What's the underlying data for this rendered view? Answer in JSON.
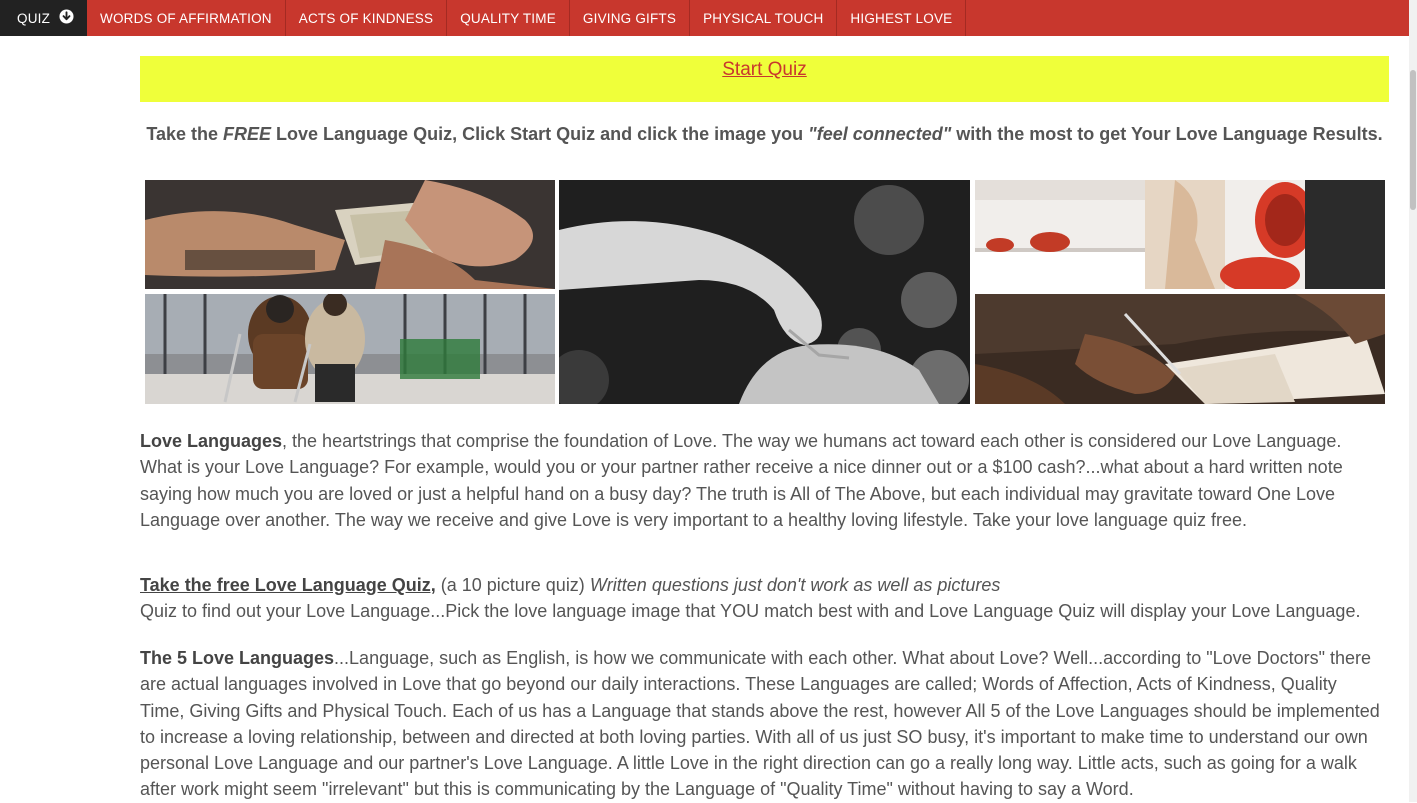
{
  "nav": {
    "items": [
      {
        "label": "QUIZ",
        "active": true
      },
      {
        "label": "WORDS OF AFFIRMATION"
      },
      {
        "label": "ACTS OF KINDNESS"
      },
      {
        "label": "QUALITY TIME"
      },
      {
        "label": "GIVING GIFTS"
      },
      {
        "label": "PHYSICAL TOUCH"
      },
      {
        "label": "HIGHEST LOVE"
      }
    ],
    "active_icon": "circle-arrow-down-icon",
    "bg_color": "#c8372d",
    "active_bg_color": "#222222"
  },
  "banner": {
    "start_label": "Start Quiz",
    "bg_color": "#efff3a"
  },
  "intro": {
    "part1": "Take the ",
    "free": "FREE",
    "part2": " Love Language Quiz, Click Start Quiz and click the image you ",
    "feel": "\"feel connected\"",
    "part3": " with the most to get Your Love Language Results."
  },
  "collage": {
    "images": [
      {
        "name": "money-in-hands-photo",
        "topic": "giving gifts"
      },
      {
        "name": "helping-man-on-crutches-photo",
        "topic": "acts of kindness"
      },
      {
        "name": "touching-hands-photo",
        "topic": "physical touch"
      },
      {
        "name": "cooking-together-photo",
        "topic": "quality time"
      },
      {
        "name": "handwritten-note-photo",
        "topic": "words of affirmation"
      }
    ]
  },
  "paragraph1": {
    "bold": "Love Languages",
    "text": ", the heartstrings that comprise the foundation of Love. The way we humans act toward each other is considered our Love Language. What is your Love Language? For example, would you or your partner rather receive a nice dinner out or a $100 cash?...what about a hard written note saying how much you are loved or just a helpful hand on a busy day? The truth is All of The Above, but each individual may gravitate toward One Love Language over another. The way we receive and give Love is very important to a healthy loving lifestyle. Take your love language quiz free."
  },
  "paragraph2": {
    "link": "Take the free Love Language Quiz,",
    "normal": " (a 10 picture quiz) ",
    "italic": "Written questions just don't work as well as pictures",
    "line2": "Quiz to find out your Love Language...Pick the love language image that YOU match best with and Love Language Quiz will display your Love Language."
  },
  "paragraph3": {
    "bold": "The 5 Love Languages",
    "text": "...Language, such as English, is how we communicate with each other. What about Love? Well...according to \"Love Doctors\" there are actual languages involved in Love that go beyond our daily interactions. These Languages are called; Words of Affection, Acts of Kindness, Quality Time, Giving Gifts and Physical Touch. Each of us has a Language that stands above the rest, however All 5 of the Love Languages should be implemented to increase a loving relationship, between and directed at both loving parties. With all of us just SO busy, it's important to make time to understand our own personal Love Language and our partner's Love Language. A little Love in the right direction can go a really long way. Little acts, such as going for a walk after work might seem \"irrelevant\" but this is communicating by the Language of \"Quality Time\" without having to say a Word."
  }
}
